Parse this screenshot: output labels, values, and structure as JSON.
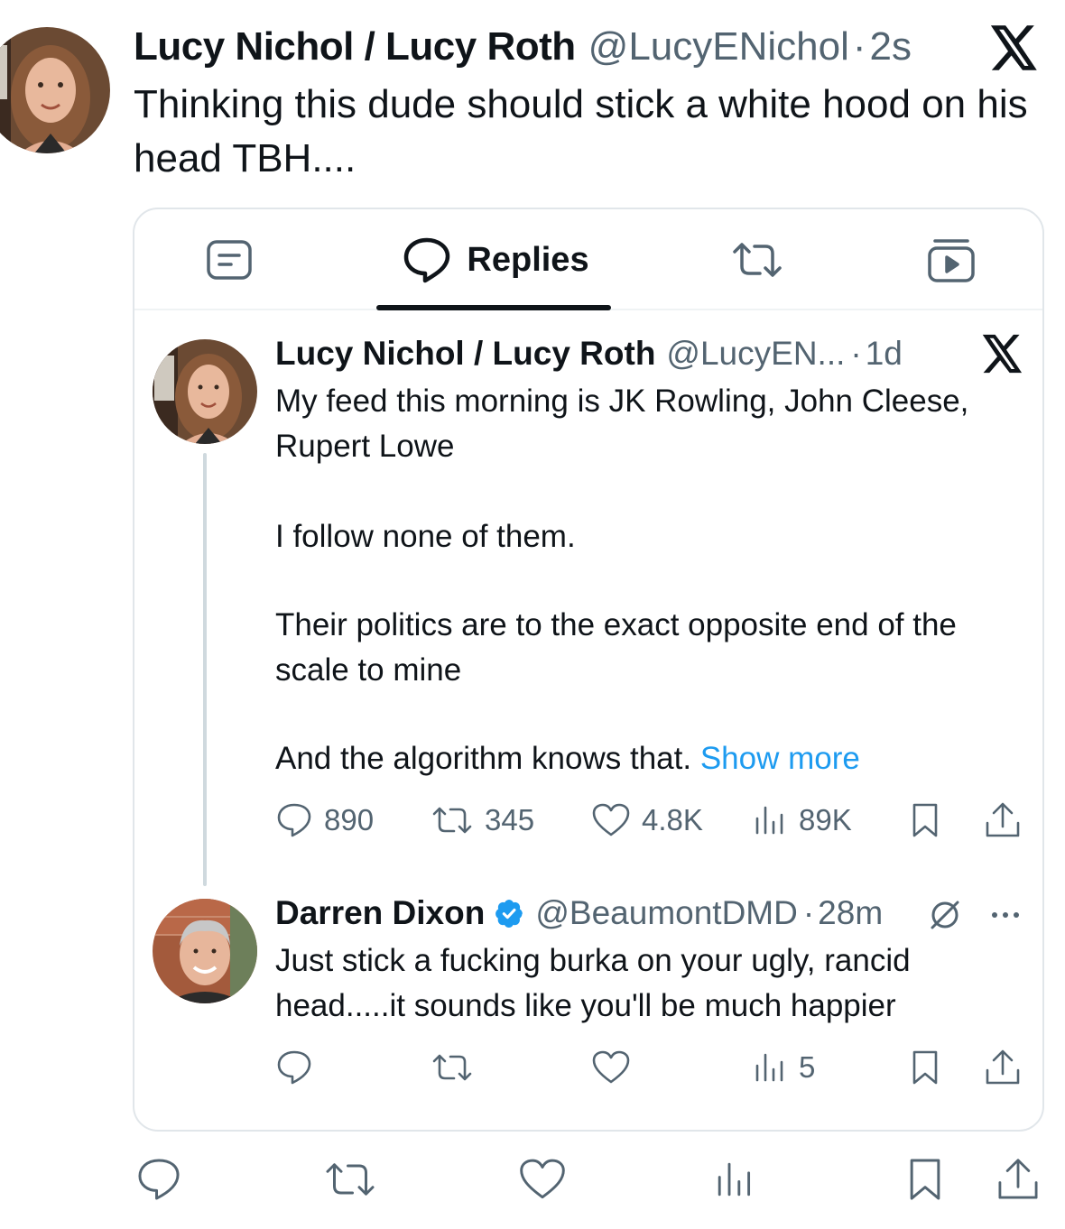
{
  "outer_tweet": {
    "name": "Lucy Nichol / Lucy Roth",
    "handle": "@LucyENichol",
    "separator": "·",
    "time": "2s",
    "text": "Thinking this dude should stick a white hood on his head TBH...."
  },
  "quoted_card": {
    "tabs": [
      {
        "icon": "article-icon"
      },
      {
        "icon": "reply-bubble-icon",
        "label": "Replies"
      },
      {
        "icon": "retweet-icon"
      },
      {
        "icon": "media-icon"
      }
    ],
    "tweet": {
      "name": "Lucy Nichol / Lucy Roth",
      "handle": "@LucyEN...",
      "separator": "·",
      "time": "1d",
      "paragraphs": [
        "My feed this morning is JK Rowling, John Cleese, Rupert Lowe",
        "I follow none of them.",
        "Their politics are to the exact opposite end of the scale to mine",
        "And the algorithm knows that."
      ],
      "show_more": "Show more",
      "stats": {
        "replies": "890",
        "retweets": "345",
        "likes": "4.8K",
        "views": "89K"
      }
    },
    "reply": {
      "name": "Darren Dixon",
      "verified": true,
      "handle": "@BeaumontDMD",
      "separator": "·",
      "time": "28m",
      "text": "Just stick a fucking burka on your ugly, rancid head.....it sounds like you'll be much happier",
      "stats": {
        "views": "5"
      }
    }
  },
  "colors": {
    "text": "#0f1419",
    "secondary": "#536471",
    "link": "#1d9bf0",
    "verified": "#1d9bf0",
    "border": "#e1e6ea"
  }
}
